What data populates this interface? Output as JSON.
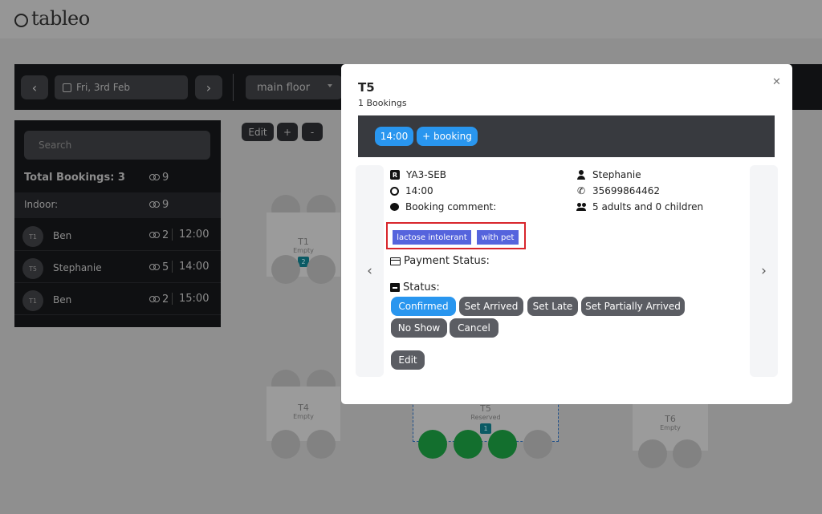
{
  "app": {
    "logo_text": "tableo"
  },
  "topbar": {
    "date": "Fri, 3rd Feb",
    "floor": "main floor",
    "prev_icon": "chevron-left-icon",
    "next_icon": "chevron-right-icon"
  },
  "sidebar": {
    "search_placeholder": "Search",
    "total_label": "Total Bookings: 3",
    "total_people": "9",
    "section_label": "Indoor:",
    "section_people": "9",
    "bookings": [
      {
        "table": "T1",
        "name": "Ben",
        "people": "2",
        "time": "12:00"
      },
      {
        "table": "T5",
        "name": "Stephanie",
        "people": "5",
        "time": "14:00"
      },
      {
        "table": "T1",
        "name": "Ben",
        "people": "2",
        "time": "15:00"
      }
    ]
  },
  "floor_tools": {
    "edit": "Edit",
    "plus": "+",
    "minus": "-"
  },
  "tables": [
    {
      "name": "T1",
      "status": "Empty",
      "count": "2"
    },
    {
      "name": "T4",
      "status": "Empty"
    },
    {
      "name": "T5",
      "status": "Reserved",
      "count": "1"
    },
    {
      "name": "T6",
      "status": "Empty"
    }
  ],
  "modal": {
    "title": "T5",
    "subtitle": "1 Bookings",
    "close_icon": "close-icon",
    "time_pill": "14:00",
    "add_booking": "+ booking",
    "booking": {
      "code": "YA3-SEB",
      "time": "14:00",
      "comment_label": "Booking comment:",
      "guest_name": "Stephanie",
      "phone": "35699864462",
      "party": "5 adults and 0 children",
      "tags": [
        "lactose intolerant",
        "with pet"
      ],
      "payment_status_label": "Payment Status:",
      "status_label": "Status:",
      "status_buttons": [
        "Confirmed",
        "Set Arrived",
        "Set Late",
        "Set Partially Arrived",
        "No Show",
        "Cancel"
      ],
      "active_status": "Confirmed",
      "edit_label": "Edit"
    },
    "colors": {
      "accent": "#2996ef",
      "tag": "#5564dd",
      "highlight_border": "#d8262c"
    }
  }
}
